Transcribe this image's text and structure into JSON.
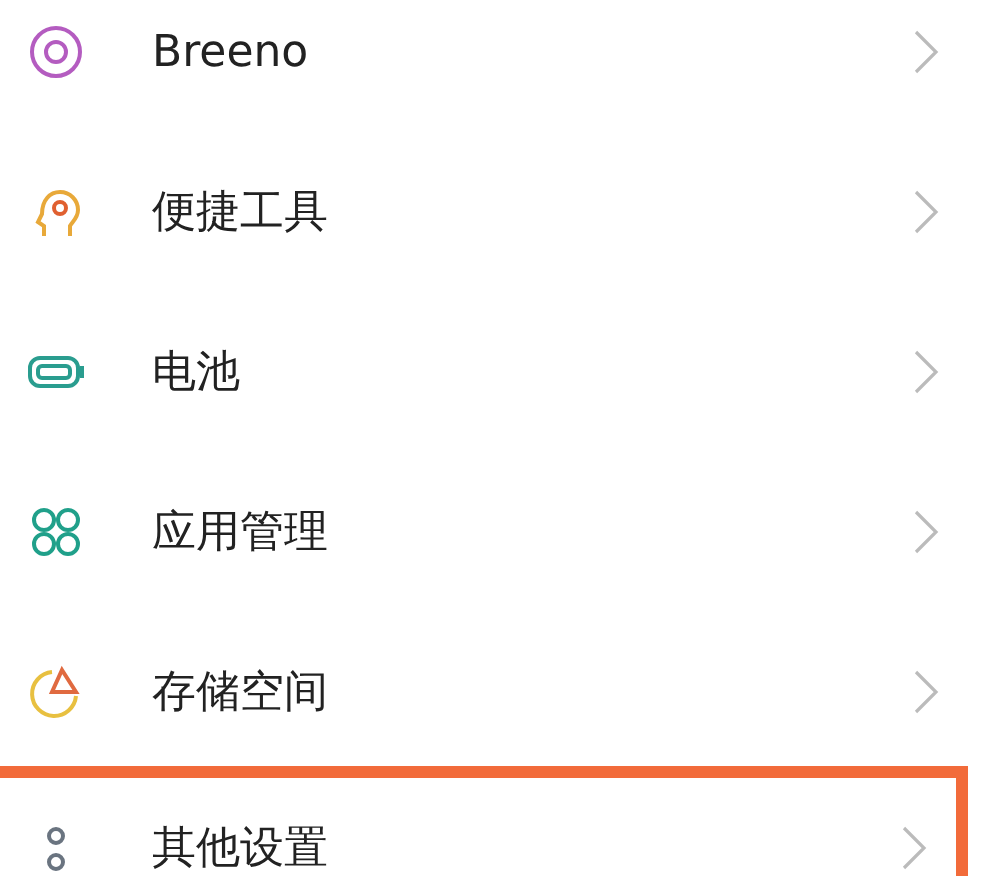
{
  "items": [
    {
      "label": "Breeno",
      "highlighted": false
    },
    {
      "label": "便捷工具",
      "highlighted": false
    },
    {
      "label": "电池",
      "highlighted": false
    },
    {
      "label": "应用管理",
      "highlighted": false
    },
    {
      "label": "存储空间",
      "highlighted": false
    },
    {
      "label": "其他设置",
      "highlighted": true
    }
  ]
}
